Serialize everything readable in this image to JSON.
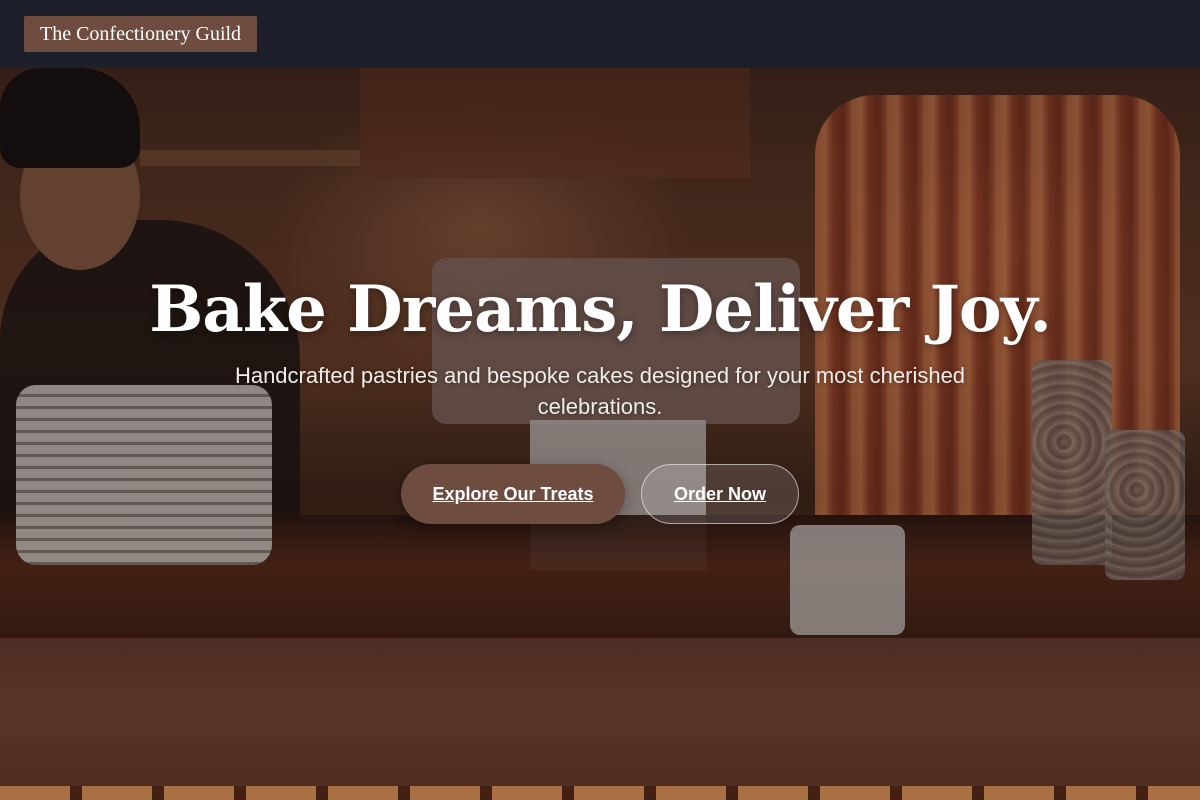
{
  "header": {
    "brand": "The Confectionery Guild"
  },
  "hero": {
    "title": "Bake Dreams, Deliver Joy.",
    "subtitle": "Handcrafted pastries and bespoke cakes designed for your most cherished celebrations.",
    "primary_cta": "Explore Our Treats",
    "secondary_cta": "Order Now"
  },
  "colors": {
    "header_bg": "#1c202c",
    "brand_accent": "#6e4c40",
    "text_light": "#ffffff"
  }
}
